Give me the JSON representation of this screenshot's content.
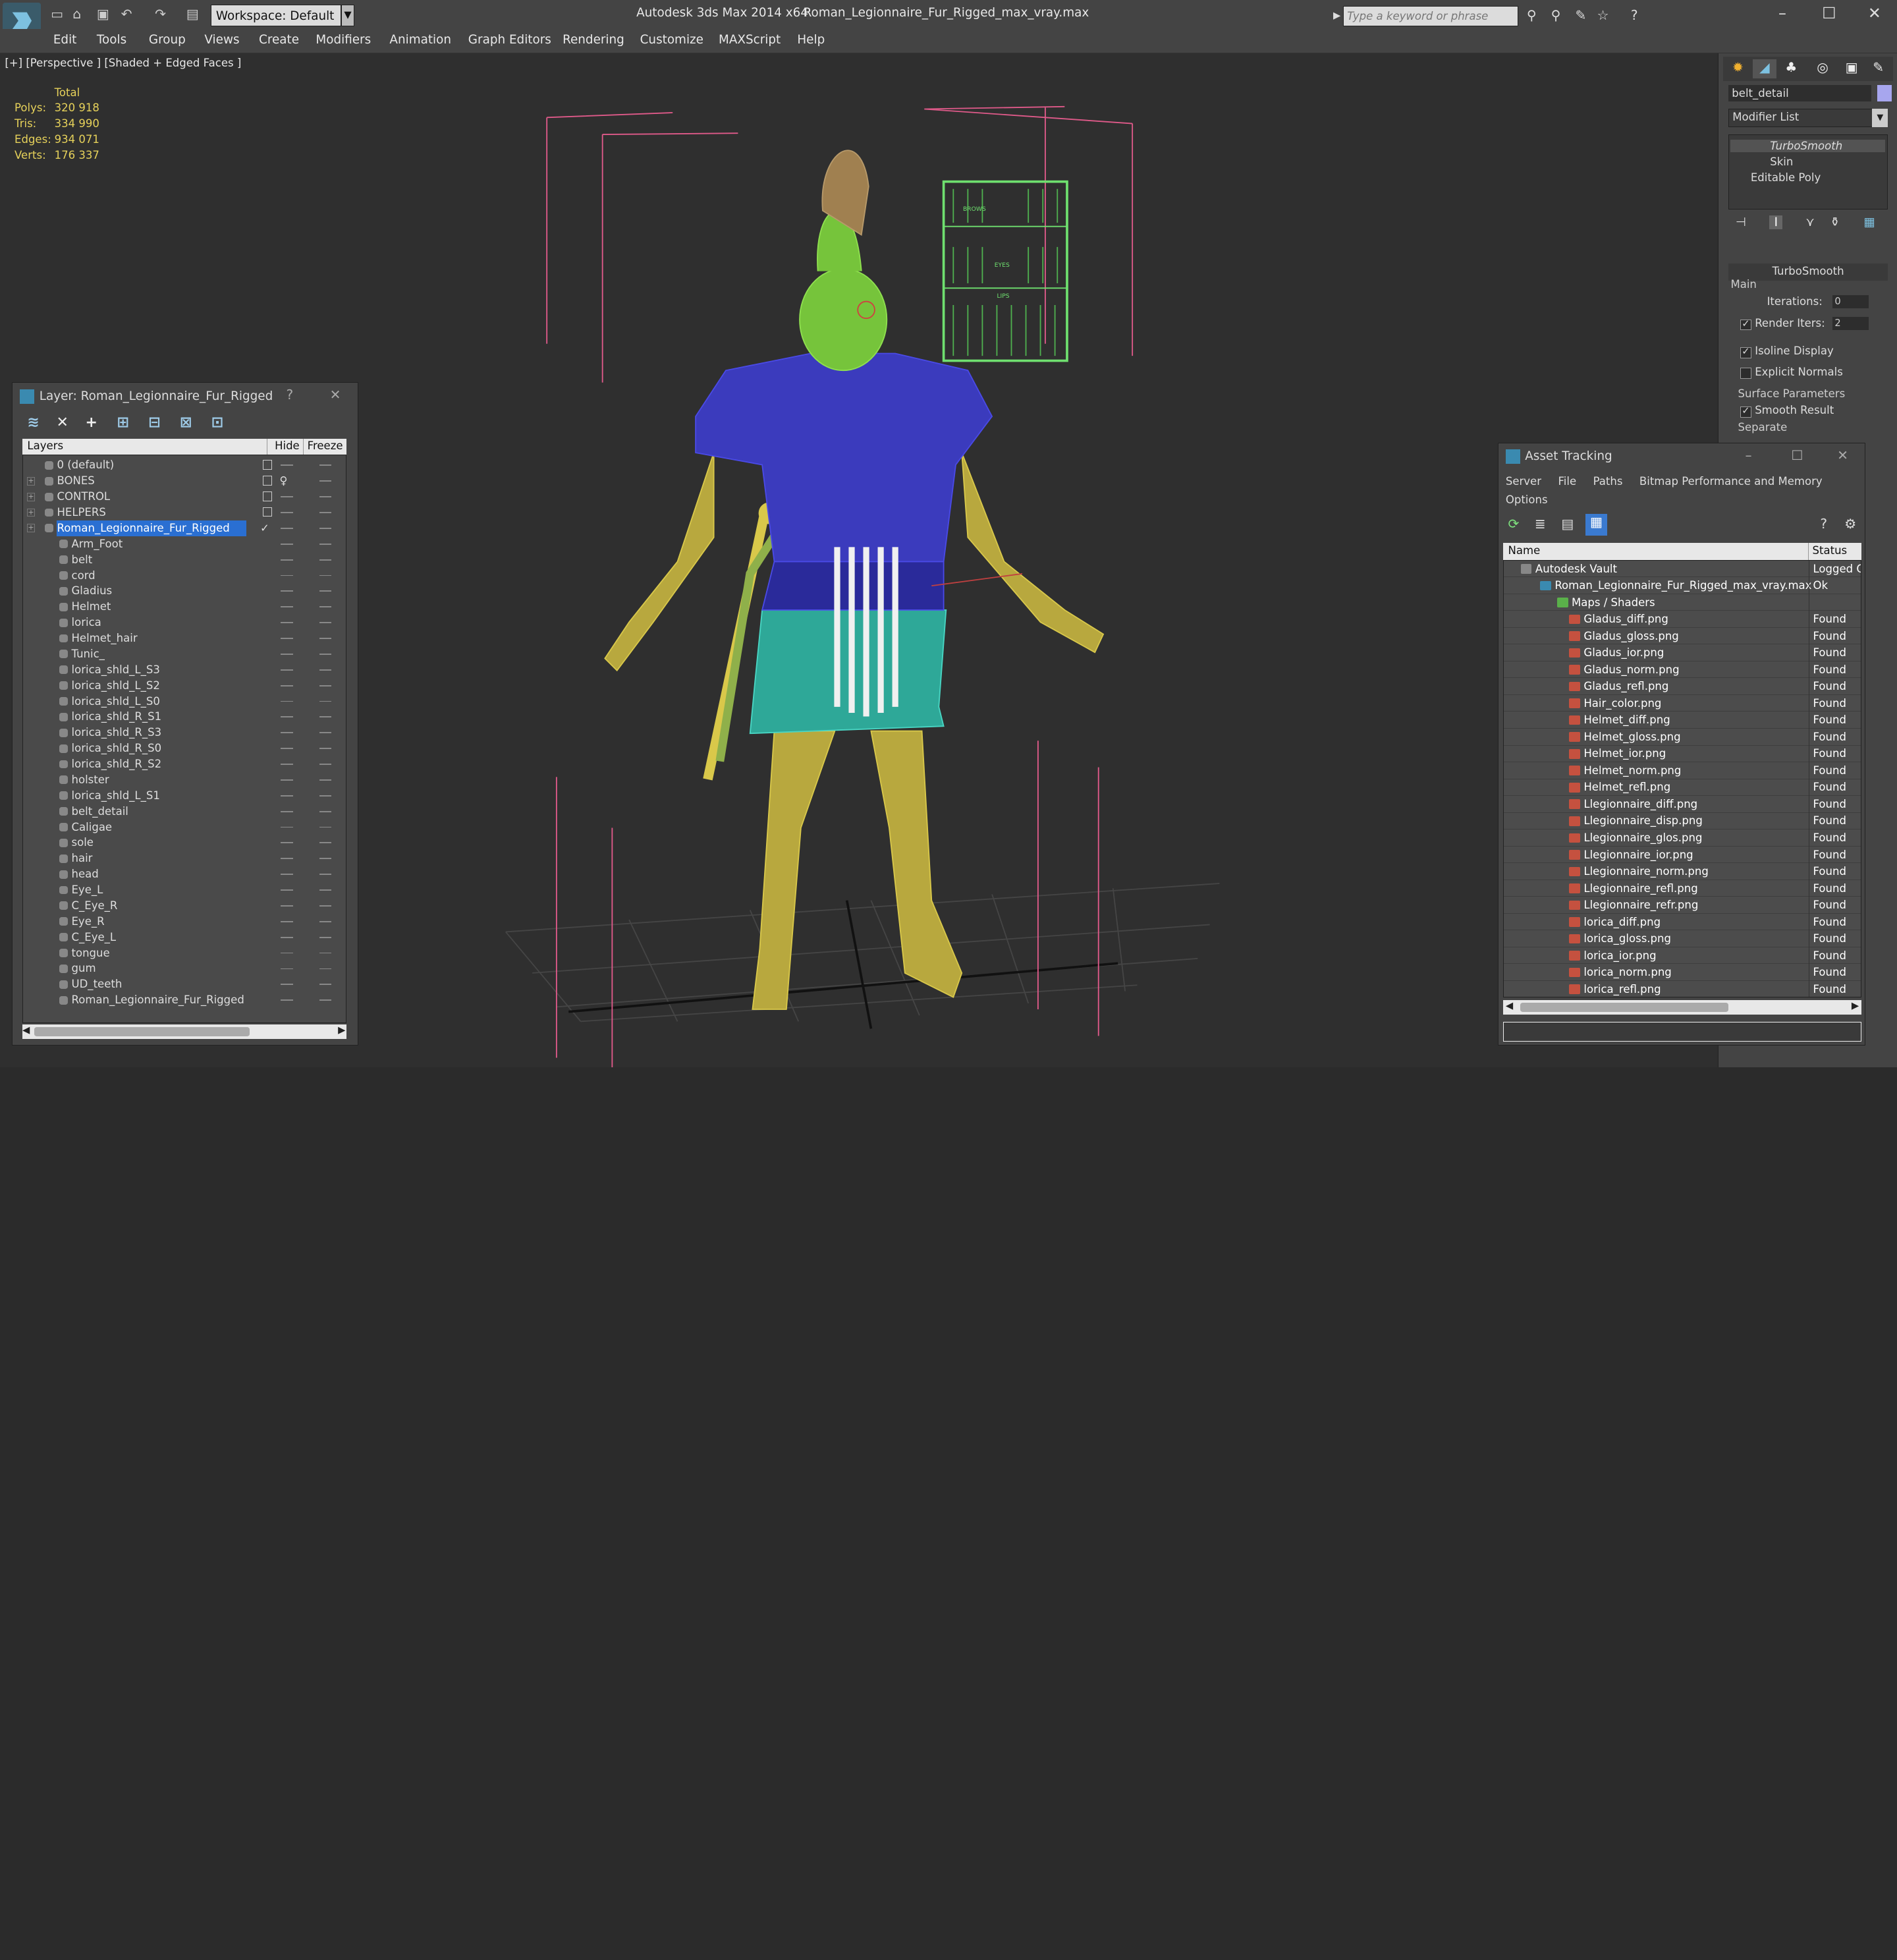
{
  "window": {
    "app_title": "Autodesk 3ds Max  2014 x64",
    "doc_title": "Roman_Legionnaire_Fur_Rigged_max_vray.max",
    "workspace": "Workspace: Default",
    "search_placeholder": "Type a keyword or phrase"
  },
  "menu": [
    "Edit",
    "Tools",
    "Group",
    "Views",
    "Create",
    "Modifiers",
    "Animation",
    "Graph Editors",
    "Rendering",
    "Customize",
    "MAXScript",
    "Help"
  ],
  "viewport": {
    "label": "[+] [Perspective ] [Shaded + Edged Faces ]",
    "stats": {
      "header": "Total",
      "polys_label": "Polys:",
      "polys": "320 918",
      "tris_label": "Tris:",
      "tris": "334 990",
      "edges_label": "Edges:",
      "edges": "934 071",
      "verts_label": "Verts:",
      "verts": "176 337"
    },
    "rig_panel": {
      "row1": "BROWS",
      "row2": "EYES",
      "row3": "LIPS"
    }
  },
  "command_panel": {
    "object_name": "belt_detail",
    "object_color": "#a7a6ee",
    "modifier_list": "Modifier List",
    "stack": [
      "TurboSmooth",
      "Skin",
      "Editable Poly"
    ],
    "rollout_title": "TurboSmooth",
    "main_group": "Main",
    "iterations_label": "Iterations:",
    "iterations": "0",
    "render_iters_label": "Render Iters:",
    "render_iters": "2",
    "isoline_label": "Isoline Display",
    "explicit_label": "Explicit Normals",
    "surface_group": "Surface Parameters",
    "smooth_label": "Smooth Result",
    "separate_label": "Separate"
  },
  "layer_panel": {
    "title": "Layer: Roman_Legionnaire_Fur_Rigged",
    "help": "?",
    "col_layers": "Layers",
    "col_hide": "Hide",
    "col_freeze": "Freeze",
    "rows": [
      {
        "name": "0 (default)",
        "level": 0,
        "expander": false,
        "type": "layer"
      },
      {
        "name": "BONES",
        "level": 0,
        "expander": true,
        "type": "layer",
        "light": true
      },
      {
        "name": "CONTROL",
        "level": 0,
        "expander": true,
        "type": "layer"
      },
      {
        "name": "HELPERS",
        "level": 0,
        "expander": true,
        "type": "layer"
      },
      {
        "name": "Roman_Legionnaire_Fur_Rigged",
        "level": 0,
        "expander": true,
        "type": "layer",
        "selected": true
      },
      {
        "name": "Arm_Foot",
        "level": 1,
        "type": "object"
      },
      {
        "name": "belt",
        "level": 1,
        "type": "object"
      },
      {
        "name": "cord",
        "level": 1,
        "type": "object"
      },
      {
        "name": "Gladius",
        "level": 1,
        "type": "object"
      },
      {
        "name": "Helmet",
        "level": 1,
        "type": "object"
      },
      {
        "name": "lorica",
        "level": 1,
        "type": "object"
      },
      {
        "name": "Helmet_hair",
        "level": 1,
        "type": "object"
      },
      {
        "name": "Tunic_",
        "level": 1,
        "type": "object"
      },
      {
        "name": "lorica_shld_L_S3",
        "level": 1,
        "type": "object"
      },
      {
        "name": "lorica_shld_L_S2",
        "level": 1,
        "type": "object"
      },
      {
        "name": "lorica_shld_L_S0",
        "level": 1,
        "type": "object"
      },
      {
        "name": "lorica_shld_R_S1",
        "level": 1,
        "type": "object"
      },
      {
        "name": "lorica_shld_R_S3",
        "level": 1,
        "type": "object"
      },
      {
        "name": "lorica_shld_R_S0",
        "level": 1,
        "type": "object"
      },
      {
        "name": "lorica_shld_R_S2",
        "level": 1,
        "type": "object"
      },
      {
        "name": "holster",
        "level": 1,
        "type": "object"
      },
      {
        "name": "lorica_shld_L_S1",
        "level": 1,
        "type": "object"
      },
      {
        "name": "belt_detail",
        "level": 1,
        "type": "object"
      },
      {
        "name": "Caligae",
        "level": 1,
        "type": "object"
      },
      {
        "name": "sole",
        "level": 1,
        "type": "object"
      },
      {
        "name": "hair",
        "level": 1,
        "type": "object"
      },
      {
        "name": "head",
        "level": 1,
        "type": "object"
      },
      {
        "name": "Eye_L",
        "level": 1,
        "type": "object"
      },
      {
        "name": "C_Eye_R",
        "level": 1,
        "type": "object"
      },
      {
        "name": "Eye_R",
        "level": 1,
        "type": "object"
      },
      {
        "name": "C_Eye_L",
        "level": 1,
        "type": "object"
      },
      {
        "name": "tongue",
        "level": 1,
        "type": "object"
      },
      {
        "name": "gum",
        "level": 1,
        "type": "object"
      },
      {
        "name": "UD_teeth",
        "level": 1,
        "type": "object"
      },
      {
        "name": "Roman_Legionnaire_Fur_Rigged",
        "level": 1,
        "type": "object"
      }
    ]
  },
  "asset_panel": {
    "title": "Asset Tracking",
    "menu": [
      "Server",
      "File",
      "Paths",
      "Bitmap Performance and Memory",
      "Options"
    ],
    "col_name": "Name",
    "col_status": "Status",
    "rows": [
      {
        "name": "Autodesk Vault",
        "status": "Logged O",
        "level": 0,
        "icon": "vault"
      },
      {
        "name": "Roman_Legionnaire_Fur_Rigged_max_vray.max",
        "status": "Ok",
        "level": 1,
        "icon": "maxfile"
      },
      {
        "name": "Maps / Shaders",
        "status": "",
        "level": 2,
        "icon": "folder"
      },
      {
        "name": "Gladus_diff.png",
        "status": "Found",
        "level": 3,
        "icon": "png"
      },
      {
        "name": "Gladus_gloss.png",
        "status": "Found",
        "level": 3,
        "icon": "png"
      },
      {
        "name": "Gladus_ior.png",
        "status": "Found",
        "level": 3,
        "icon": "png"
      },
      {
        "name": "Gladus_norm.png",
        "status": "Found",
        "level": 3,
        "icon": "png"
      },
      {
        "name": "Gladus_refl.png",
        "status": "Found",
        "level": 3,
        "icon": "png"
      },
      {
        "name": "Hair_color.png",
        "status": "Found",
        "level": 3,
        "icon": "png"
      },
      {
        "name": "Helmet_diff.png",
        "status": "Found",
        "level": 3,
        "icon": "png"
      },
      {
        "name": "Helmet_gloss.png",
        "status": "Found",
        "level": 3,
        "icon": "png"
      },
      {
        "name": "Helmet_ior.png",
        "status": "Found",
        "level": 3,
        "icon": "png"
      },
      {
        "name": "Helmet_norm.png",
        "status": "Found",
        "level": 3,
        "icon": "png"
      },
      {
        "name": "Helmet_refl.png",
        "status": "Found",
        "level": 3,
        "icon": "png"
      },
      {
        "name": "Llegionnaire_diff.png",
        "status": "Found",
        "level": 3,
        "icon": "png"
      },
      {
        "name": "Llegionnaire_disp.png",
        "status": "Found",
        "level": 3,
        "icon": "png"
      },
      {
        "name": "Llegionnaire_glos.png",
        "status": "Found",
        "level": 3,
        "icon": "png"
      },
      {
        "name": "Llegionnaire_ior.png",
        "status": "Found",
        "level": 3,
        "icon": "png"
      },
      {
        "name": "Llegionnaire_norm.png",
        "status": "Found",
        "level": 3,
        "icon": "png"
      },
      {
        "name": "Llegionnaire_refl.png",
        "status": "Found",
        "level": 3,
        "icon": "png"
      },
      {
        "name": "Llegionnaire_refr.png",
        "status": "Found",
        "level": 3,
        "icon": "png"
      },
      {
        "name": "lorica_diff.png",
        "status": "Found",
        "level": 3,
        "icon": "png"
      },
      {
        "name": "lorica_gloss.png",
        "status": "Found",
        "level": 3,
        "icon": "png"
      },
      {
        "name": "lorica_ior.png",
        "status": "Found",
        "level": 3,
        "icon": "png"
      },
      {
        "name": "lorica_norm.png",
        "status": "Found",
        "level": 3,
        "icon": "png"
      },
      {
        "name": "lorica_refl.png",
        "status": "Found",
        "level": 3,
        "icon": "png"
      }
    ]
  },
  "colors": {
    "stats_text": "#e6d15a",
    "selection": "#2a6fd2",
    "wire_skin": "#d9c84a",
    "wire_armor": "#4a4ae6",
    "wire_tunic": "#49d6c4",
    "wire_helmet": "#8fe04f",
    "helper_lines": "#e05a8a"
  }
}
